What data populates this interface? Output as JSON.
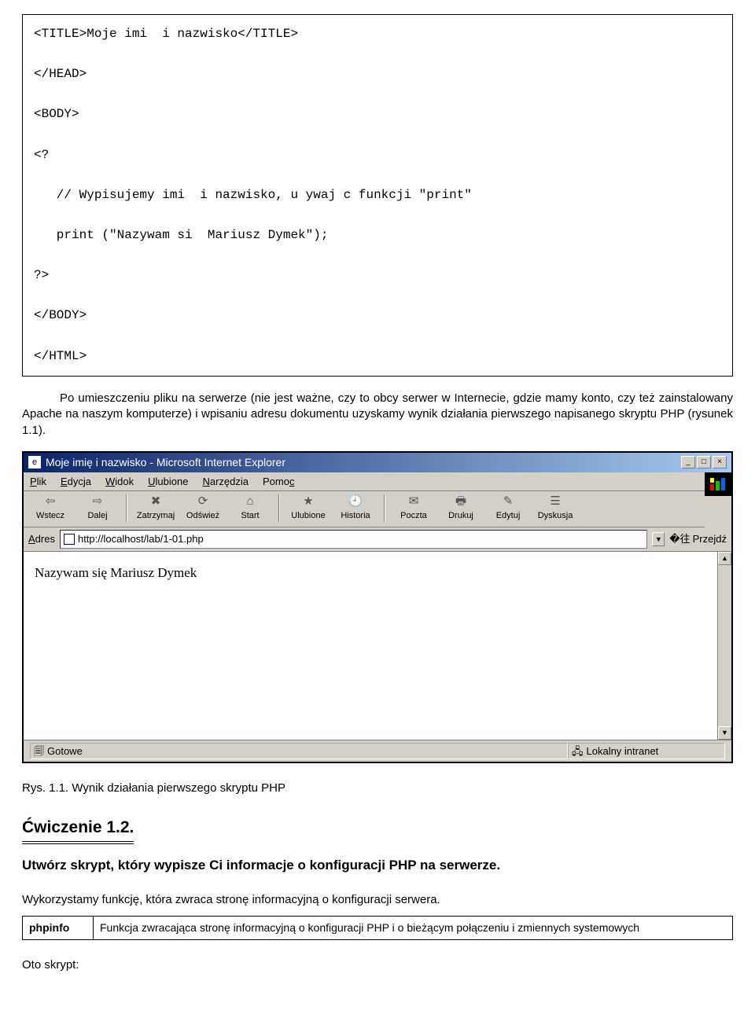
{
  "code_block": "<TITLE>Moje imi  i nazwisko</TITLE>\n\n</HEAD>\n\n<BODY>\n\n<?\n\n   // Wypisujemy imi  i nazwisko, u ywaj c funkcji \"print\"\n\n   print (\"Nazywam si  Mariusz Dymek\");\n\n?>\n\n</BODY>\n\n</HTML>",
  "para1": "Po umieszczeniu pliku na serwerze (nie jest ważne, czy to obcy serwer w Internecie, gdzie mamy konto, czy też zainstalowany Apache na naszym komputerze) i wpisaniu adresu dokumentu uzyskamy wynik działania pierwszego napisanego skryptu PHP (rysunek 1.1).",
  "browser": {
    "title": "Moje imię i nazwisko - Microsoft Internet Explorer",
    "menus": {
      "m1": "Plik",
      "m2": "Edycja",
      "m3": "Widok",
      "m4": "Ulubione",
      "m5": "Narzędzia",
      "m6": "Pomoc"
    },
    "toolbar": {
      "b1": "Wstecz",
      "b2": "Dalej",
      "b3": "Zatrzymaj",
      "b4": "Odśwież",
      "b5": "Start",
      "b6": "Ulubione",
      "b7": "Historia",
      "b8": "Poczta",
      "b9": "Drukuj",
      "b10": "Edytuj",
      "b11": "Dyskusja"
    },
    "addr_label": "Adres",
    "addr_value": "http://localhost/lab/1-01.php",
    "go_label": "Przejdź",
    "content": "Nazywam się Mariusz Dymek",
    "status_left": "Gotowe",
    "status_right": "Lokalny intranet"
  },
  "fig_cap": "Rys. 1.1. Wynik działania pierwszego skryptu PHP",
  "exercise_heading": "Ćwiczenie 1.2.",
  "exercise_desc": "Utwórz skrypt, który wypisze Ci informacje o konfiguracji PHP na serwerze.",
  "body_text": "Wykorzystamy funkcję, która zwraca stronę informacyjną o konfiguracji serwera.",
  "fn_name": "phpinfo",
  "fn_desc": "Funkcja zwracająca stronę informacyjną o konfiguracji PHP i o bieżącym połączeniu i zmiennych systemowych",
  "last": "Oto skrypt:"
}
